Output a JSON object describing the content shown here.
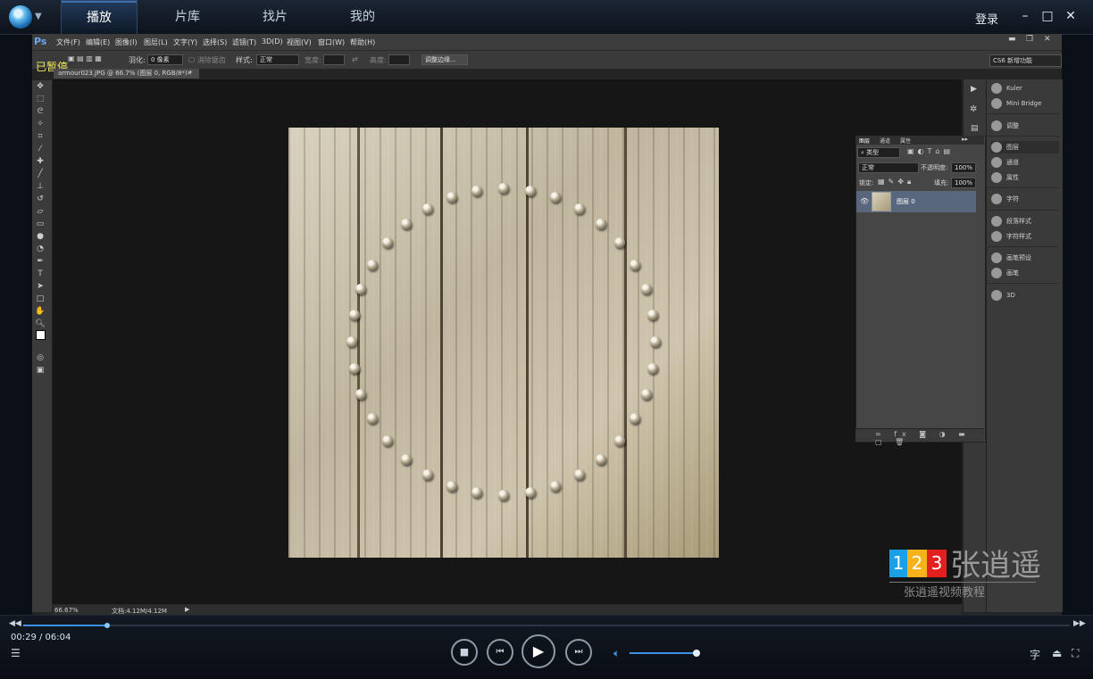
{
  "player": {
    "tabs": [
      "播放",
      "片库",
      "找片",
      "我的"
    ],
    "active_tab": "播放",
    "login_label": "登录",
    "paused_label": "已暂停",
    "current_time": "00:29",
    "total_time": "/ 06:04",
    "progress": 0.08,
    "volume": 1.0
  },
  "photoshop": {
    "logo": "Ps",
    "menu": [
      "文件(F)",
      "编辑(E)",
      "图像(I)",
      "图层(L)",
      "文字(Y)",
      "选择(S)",
      "滤镜(T)",
      "3D(D)",
      "视图(V)",
      "窗口(W)",
      "帮助(H)"
    ],
    "options": {
      "feather_label": "羽化:",
      "feather_value": "0 像素",
      "antialias_label": "消除锯齿",
      "style_label": "样式:",
      "style_value": "正常",
      "width_label": "宽度:",
      "height_label": "高度:",
      "refine_edge": "调整边缘..."
    },
    "workspace": "CS6 新增功能",
    "document_tab": "armour023.JPG @ 66.7% (图层 0, RGB/8*) *",
    "zoom": "66.67%",
    "doc_size": "文档:4.12M/4.12M",
    "dock": [
      "Kuler",
      "Mini Bridge",
      "调整",
      "图层",
      "通道",
      "属性",
      "字符",
      "段落样式",
      "字符样式",
      "画笔预设",
      "画笔",
      "3D"
    ],
    "layers_panel": {
      "tabs": [
        "图层",
        "通道",
        "属性"
      ],
      "kind_label": "类型",
      "blend_mode": "正常",
      "opacity_label": "不透明度:",
      "opacity_value": "100%",
      "lock_label": "锁定:",
      "fill_label": "填充:",
      "fill_value": "100%",
      "layer_name": "图层 0"
    }
  },
  "watermark": {
    "digits": [
      "1",
      "2",
      "3"
    ],
    "name": "张逍遥",
    "subtitle": "张逍遥视频教程",
    "colors": [
      "#19a0e6",
      "#f6b21a",
      "#e3201e"
    ]
  }
}
